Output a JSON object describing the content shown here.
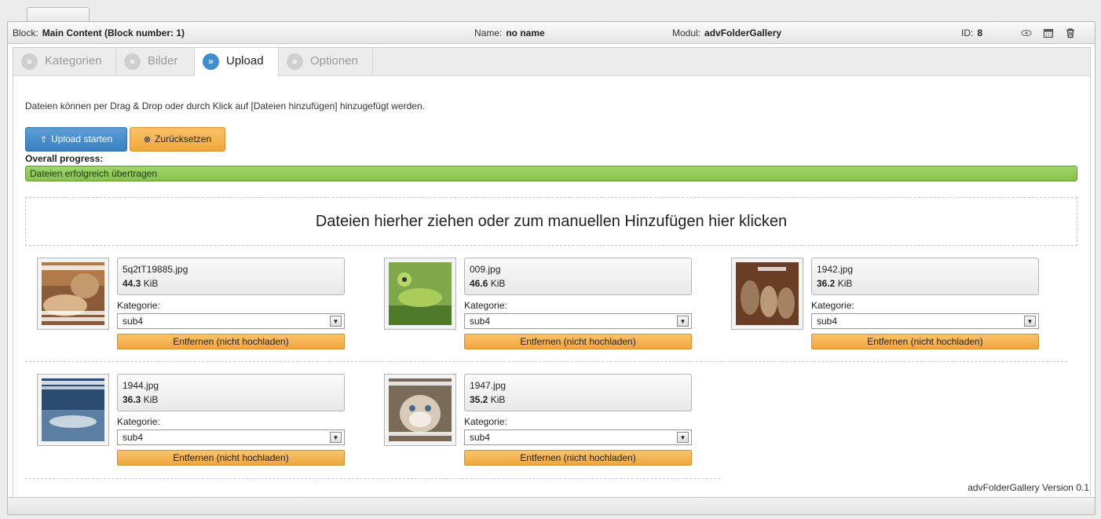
{
  "infobar": {
    "block_label": "Block:",
    "block_value": "Main Content (Block number: 1)",
    "name_label": "Name:",
    "name_value": "no name",
    "modul_label": "Modul:",
    "modul_value": "advFolderGallery",
    "id_label": "ID:",
    "id_value": "8",
    "icons": [
      "eye-icon",
      "calendar-icon",
      "trash-icon"
    ]
  },
  "tabs": [
    {
      "label": "Kategorien",
      "active": false
    },
    {
      "label": "Bilder",
      "active": false
    },
    {
      "label": "Upload",
      "active": true
    },
    {
      "label": "Optionen",
      "active": false
    }
  ],
  "intro": "Dateien können per Drag & Drop oder durch Klick auf [Dateien hinzufügen] hinzugefügt werden.",
  "buttons": {
    "start_upload": "Upload starten",
    "reset": "Zurücksetzen"
  },
  "progress": {
    "label": "Overall progress:",
    "status": "Dateien erfolgreich übertragen",
    "percent": 100,
    "color": "#8cc653"
  },
  "dropzone_text": "Dateien hierher ziehen oder zum manuellen Hinzufügen hier klicken",
  "files": [
    {
      "name": "5q2tT19885.jpg",
      "size": "44.3",
      "unit": " KiB",
      "category_label": "Kategorie:",
      "category": "sub4",
      "remove_label": "Entfernen (nicht hochladen)"
    },
    {
      "name": "009.jpg",
      "size": "46.6",
      "unit": " KiB",
      "category_label": "Kategorie:",
      "category": "sub4",
      "remove_label": "Entfernen (nicht hochladen)"
    },
    {
      "name": "1942.jpg",
      "size": "36.2",
      "unit": " KiB",
      "category_label": "Kategorie:",
      "category": "sub4",
      "remove_label": "Entfernen (nicht hochladen)"
    },
    {
      "name": "1944.jpg",
      "size": "36.3",
      "unit": " KiB",
      "category_label": "Kategorie:",
      "category": "sub4",
      "remove_label": "Entfernen (nicht hochladen)"
    },
    {
      "name": "1947.jpg",
      "size": "35.2",
      "unit": " KiB",
      "category_label": "Kategorie:",
      "category": "sub4",
      "remove_label": "Entfernen (nicht hochladen)"
    }
  ],
  "footer": {
    "version": "advFolderGallery Version 0.1"
  }
}
